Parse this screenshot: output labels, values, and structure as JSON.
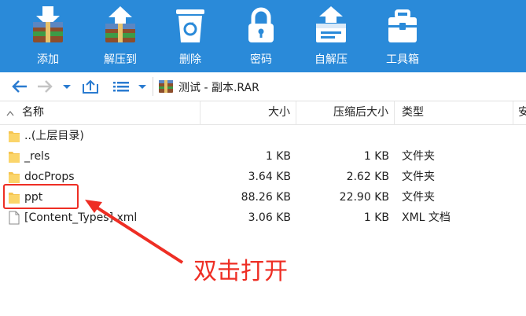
{
  "toolbar": {
    "buttons": [
      {
        "label": "添加",
        "icon": "add-archive-icon"
      },
      {
        "label": "解压到",
        "icon": "extract-to-icon"
      },
      {
        "label": "删除",
        "icon": "recycle-bin-icon"
      },
      {
        "label": "密码",
        "icon": "padlock-icon"
      },
      {
        "label": "自解压",
        "icon": "self-extract-icon"
      },
      {
        "label": "工具箱",
        "icon": "toolbox-icon"
      }
    ]
  },
  "nav": {
    "path": "测试 - 副本.RAR",
    "icons": [
      "back-arrow-icon",
      "forward-arrow-icon",
      "history-dropdown-icon",
      "up-folder-icon",
      "list-view-icon",
      "view-dropdown-icon",
      "rar-archive-icon"
    ]
  },
  "columns": {
    "name": "名称",
    "size": "大小",
    "packed": "压缩后大小",
    "type": "类型",
    "more": "安"
  },
  "files": [
    {
      "name": "..(上层目录)",
      "size": "",
      "packed": "",
      "type": "",
      "icon": "folder-icon"
    },
    {
      "name": "_rels",
      "size": "1 KB",
      "packed": "1 KB",
      "type": "文件夹",
      "icon": "folder-icon"
    },
    {
      "name": "docProps",
      "size": "3.64 KB",
      "packed": "2.62 KB",
      "type": "文件夹",
      "icon": "folder-icon"
    },
    {
      "name": "ppt",
      "size": "88.26 KB",
      "packed": "22.90 KB",
      "type": "文件夹",
      "icon": "folder-icon"
    },
    {
      "name": "[Content_Types].xml",
      "size": "3.06 KB",
      "packed": "1 KB",
      "type": "XML 文档",
      "icon": "document-icon"
    }
  ],
  "annotation": {
    "text": "双击打开",
    "color": "#ee2e24"
  },
  "colors": {
    "toolbar_bg": "#2a8ad9",
    "folder": "#f5c451",
    "annotation": "#ee2e24"
  }
}
